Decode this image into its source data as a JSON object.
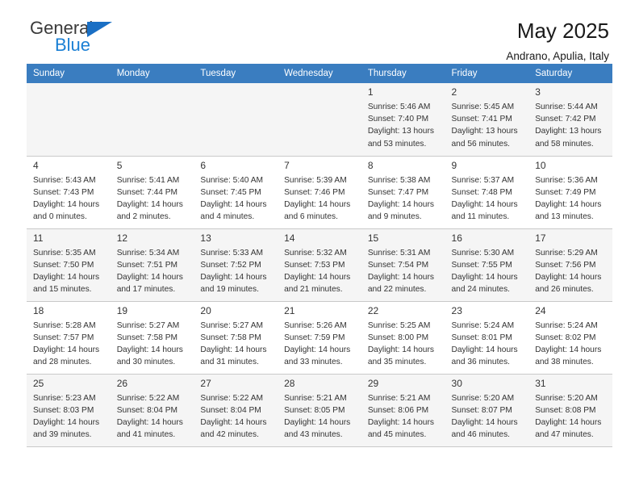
{
  "brand": {
    "name_top": "General",
    "name_bottom": "Blue",
    "color_primary": "#1a7fd4",
    "color_triangle": "#1a6fc4"
  },
  "header": {
    "month_title": "May 2025",
    "location": "Andrano, Apulia, Italy"
  },
  "calendar": {
    "header_bg": "#3a7dc0",
    "columns": [
      "Sunday",
      "Monday",
      "Tuesday",
      "Wednesday",
      "Thursday",
      "Friday",
      "Saturday"
    ],
    "weeks": [
      [
        {
          "day": "",
          "sunrise": "",
          "sunset": "",
          "daylight": "",
          "daylight2": "",
          "empty": true
        },
        {
          "day": "",
          "sunrise": "",
          "sunset": "",
          "daylight": "",
          "daylight2": "",
          "empty": true
        },
        {
          "day": "",
          "sunrise": "",
          "sunset": "",
          "daylight": "",
          "daylight2": "",
          "empty": true
        },
        {
          "day": "",
          "sunrise": "",
          "sunset": "",
          "daylight": "",
          "daylight2": "",
          "empty": true
        },
        {
          "day": "1",
          "sunrise": "Sunrise: 5:46 AM",
          "sunset": "Sunset: 7:40 PM",
          "daylight": "Daylight: 13 hours",
          "daylight2": "and 53 minutes."
        },
        {
          "day": "2",
          "sunrise": "Sunrise: 5:45 AM",
          "sunset": "Sunset: 7:41 PM",
          "daylight": "Daylight: 13 hours",
          "daylight2": "and 56 minutes."
        },
        {
          "day": "3",
          "sunrise": "Sunrise: 5:44 AM",
          "sunset": "Sunset: 7:42 PM",
          "daylight": "Daylight: 13 hours",
          "daylight2": "and 58 minutes."
        }
      ],
      [
        {
          "day": "4",
          "sunrise": "Sunrise: 5:43 AM",
          "sunset": "Sunset: 7:43 PM",
          "daylight": "Daylight: 14 hours",
          "daylight2": "and 0 minutes."
        },
        {
          "day": "5",
          "sunrise": "Sunrise: 5:41 AM",
          "sunset": "Sunset: 7:44 PM",
          "daylight": "Daylight: 14 hours",
          "daylight2": "and 2 minutes."
        },
        {
          "day": "6",
          "sunrise": "Sunrise: 5:40 AM",
          "sunset": "Sunset: 7:45 PM",
          "daylight": "Daylight: 14 hours",
          "daylight2": "and 4 minutes."
        },
        {
          "day": "7",
          "sunrise": "Sunrise: 5:39 AM",
          "sunset": "Sunset: 7:46 PM",
          "daylight": "Daylight: 14 hours",
          "daylight2": "and 6 minutes."
        },
        {
          "day": "8",
          "sunrise": "Sunrise: 5:38 AM",
          "sunset": "Sunset: 7:47 PM",
          "daylight": "Daylight: 14 hours",
          "daylight2": "and 9 minutes."
        },
        {
          "day": "9",
          "sunrise": "Sunrise: 5:37 AM",
          "sunset": "Sunset: 7:48 PM",
          "daylight": "Daylight: 14 hours",
          "daylight2": "and 11 minutes."
        },
        {
          "day": "10",
          "sunrise": "Sunrise: 5:36 AM",
          "sunset": "Sunset: 7:49 PM",
          "daylight": "Daylight: 14 hours",
          "daylight2": "and 13 minutes."
        }
      ],
      [
        {
          "day": "11",
          "sunrise": "Sunrise: 5:35 AM",
          "sunset": "Sunset: 7:50 PM",
          "daylight": "Daylight: 14 hours",
          "daylight2": "and 15 minutes."
        },
        {
          "day": "12",
          "sunrise": "Sunrise: 5:34 AM",
          "sunset": "Sunset: 7:51 PM",
          "daylight": "Daylight: 14 hours",
          "daylight2": "and 17 minutes."
        },
        {
          "day": "13",
          "sunrise": "Sunrise: 5:33 AM",
          "sunset": "Sunset: 7:52 PM",
          "daylight": "Daylight: 14 hours",
          "daylight2": "and 19 minutes."
        },
        {
          "day": "14",
          "sunrise": "Sunrise: 5:32 AM",
          "sunset": "Sunset: 7:53 PM",
          "daylight": "Daylight: 14 hours",
          "daylight2": "and 21 minutes."
        },
        {
          "day": "15",
          "sunrise": "Sunrise: 5:31 AM",
          "sunset": "Sunset: 7:54 PM",
          "daylight": "Daylight: 14 hours",
          "daylight2": "and 22 minutes."
        },
        {
          "day": "16",
          "sunrise": "Sunrise: 5:30 AM",
          "sunset": "Sunset: 7:55 PM",
          "daylight": "Daylight: 14 hours",
          "daylight2": "and 24 minutes."
        },
        {
          "day": "17",
          "sunrise": "Sunrise: 5:29 AM",
          "sunset": "Sunset: 7:56 PM",
          "daylight": "Daylight: 14 hours",
          "daylight2": "and 26 minutes."
        }
      ],
      [
        {
          "day": "18",
          "sunrise": "Sunrise: 5:28 AM",
          "sunset": "Sunset: 7:57 PM",
          "daylight": "Daylight: 14 hours",
          "daylight2": "and 28 minutes."
        },
        {
          "day": "19",
          "sunrise": "Sunrise: 5:27 AM",
          "sunset": "Sunset: 7:58 PM",
          "daylight": "Daylight: 14 hours",
          "daylight2": "and 30 minutes."
        },
        {
          "day": "20",
          "sunrise": "Sunrise: 5:27 AM",
          "sunset": "Sunset: 7:58 PM",
          "daylight": "Daylight: 14 hours",
          "daylight2": "and 31 minutes."
        },
        {
          "day": "21",
          "sunrise": "Sunrise: 5:26 AM",
          "sunset": "Sunset: 7:59 PM",
          "daylight": "Daylight: 14 hours",
          "daylight2": "and 33 minutes."
        },
        {
          "day": "22",
          "sunrise": "Sunrise: 5:25 AM",
          "sunset": "Sunset: 8:00 PM",
          "daylight": "Daylight: 14 hours",
          "daylight2": "and 35 minutes."
        },
        {
          "day": "23",
          "sunrise": "Sunrise: 5:24 AM",
          "sunset": "Sunset: 8:01 PM",
          "daylight": "Daylight: 14 hours",
          "daylight2": "and 36 minutes."
        },
        {
          "day": "24",
          "sunrise": "Sunrise: 5:24 AM",
          "sunset": "Sunset: 8:02 PM",
          "daylight": "Daylight: 14 hours",
          "daylight2": "and 38 minutes."
        }
      ],
      [
        {
          "day": "25",
          "sunrise": "Sunrise: 5:23 AM",
          "sunset": "Sunset: 8:03 PM",
          "daylight": "Daylight: 14 hours",
          "daylight2": "and 39 minutes."
        },
        {
          "day": "26",
          "sunrise": "Sunrise: 5:22 AM",
          "sunset": "Sunset: 8:04 PM",
          "daylight": "Daylight: 14 hours",
          "daylight2": "and 41 minutes."
        },
        {
          "day": "27",
          "sunrise": "Sunrise: 5:22 AM",
          "sunset": "Sunset: 8:04 PM",
          "daylight": "Daylight: 14 hours",
          "daylight2": "and 42 minutes."
        },
        {
          "day": "28",
          "sunrise": "Sunrise: 5:21 AM",
          "sunset": "Sunset: 8:05 PM",
          "daylight": "Daylight: 14 hours",
          "daylight2": "and 43 minutes."
        },
        {
          "day": "29",
          "sunrise": "Sunrise: 5:21 AM",
          "sunset": "Sunset: 8:06 PM",
          "daylight": "Daylight: 14 hours",
          "daylight2": "and 45 minutes."
        },
        {
          "day": "30",
          "sunrise": "Sunrise: 5:20 AM",
          "sunset": "Sunset: 8:07 PM",
          "daylight": "Daylight: 14 hours",
          "daylight2": "and 46 minutes."
        },
        {
          "day": "31",
          "sunrise": "Sunrise: 5:20 AM",
          "sunset": "Sunset: 8:08 PM",
          "daylight": "Daylight: 14 hours",
          "daylight2": "and 47 minutes."
        }
      ]
    ]
  }
}
